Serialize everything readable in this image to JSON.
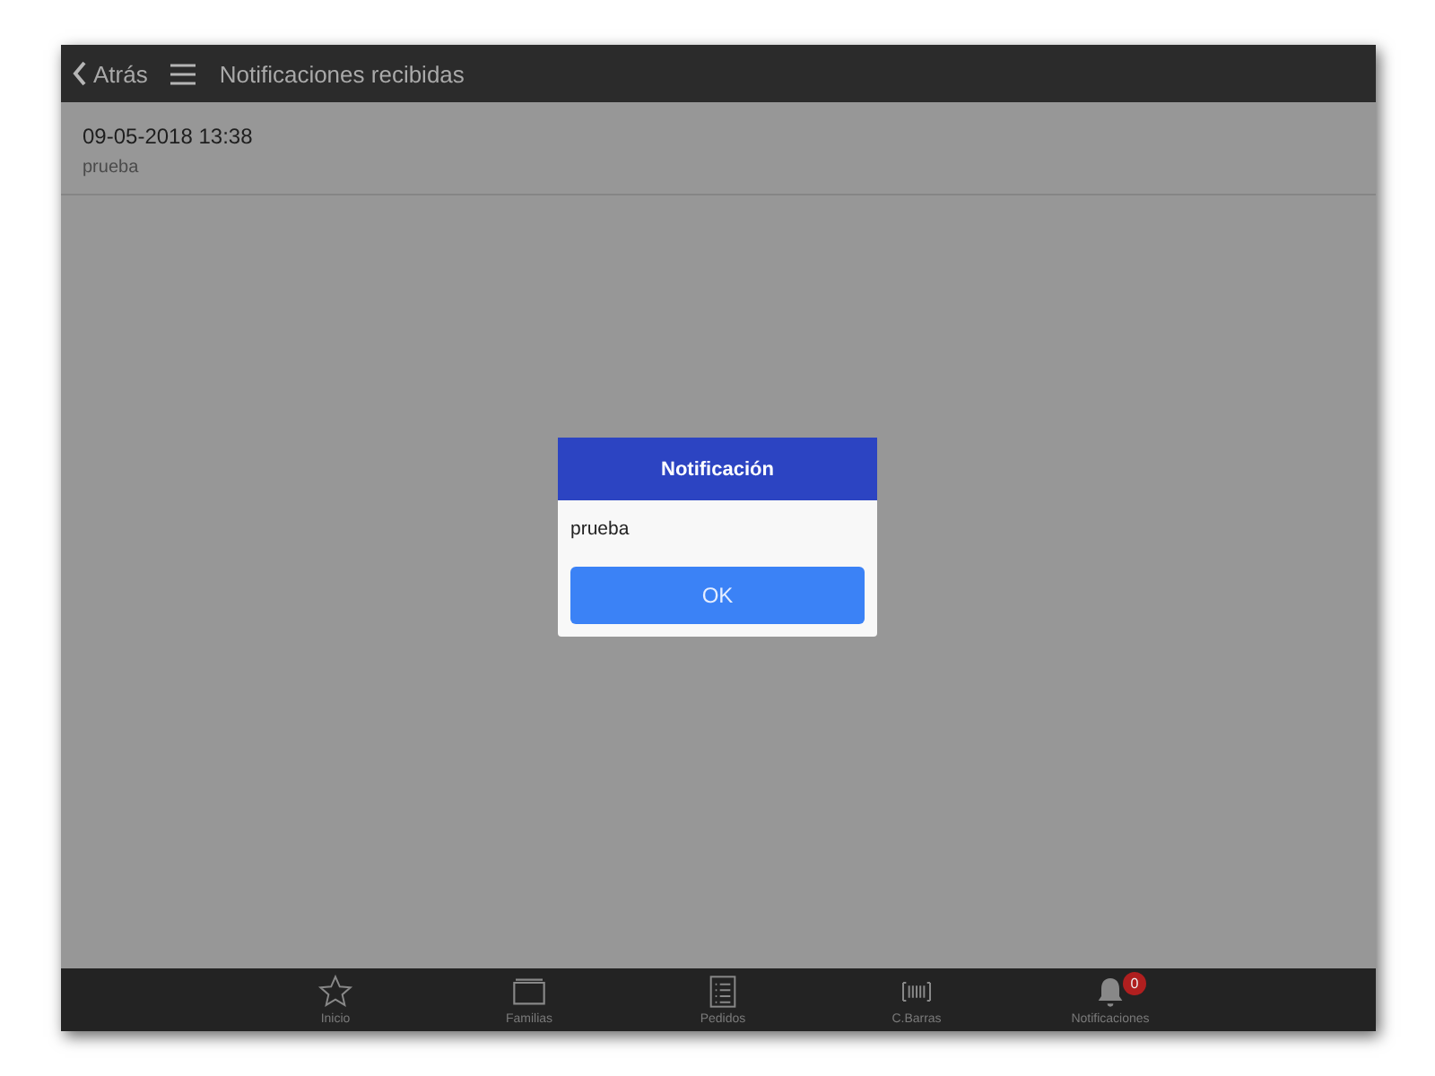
{
  "header": {
    "back": "Atrás",
    "title": "Notificaciones recibidas"
  },
  "notifications": [
    {
      "time": "09-05-2018 13:38",
      "message": "prueba"
    }
  ],
  "dialog": {
    "title": "Notificación",
    "message": "prueba",
    "button": "OK"
  },
  "tabs": [
    {
      "kind": "star",
      "label": "Inicio"
    },
    {
      "kind": "folder",
      "label": "Familias"
    },
    {
      "kind": "list",
      "label": "Pedidos"
    },
    {
      "kind": "barcode",
      "label": "C.Barras"
    },
    {
      "kind": "bell",
      "label": "Notificaciones",
      "badge": "0"
    }
  ]
}
